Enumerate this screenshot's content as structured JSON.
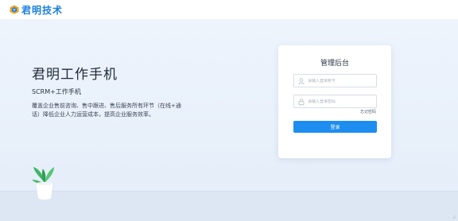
{
  "header": {
    "logo_text": "君明技术",
    "logo_icon": "jm-logo-icon",
    "brand_color": "#1a7fe0"
  },
  "hero": {
    "title": "君明工作手机",
    "subtitle": "SCRM+工作手机",
    "description": "覆盖企业售前咨询、售中跟进、售后服务所有环节（在线+通话）降低企业人力运营成本，提高企业服务效率。"
  },
  "login": {
    "title": "管理后台",
    "username_placeholder": "请输入登录账号",
    "password_placeholder": "请输入登录密码",
    "username_value": "",
    "password_value": "",
    "forgot_label": "忘记密码",
    "submit_label": "登录",
    "button_color": "#1e8df0"
  }
}
